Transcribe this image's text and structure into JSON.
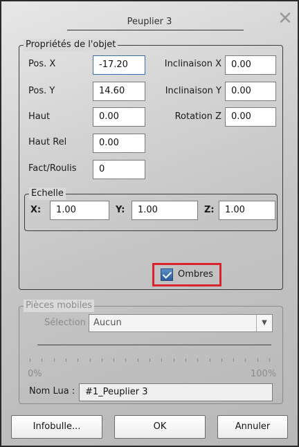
{
  "window": {
    "title": "Peuplier 3"
  },
  "props": {
    "legend": "Propriétés de l'objet",
    "pos_x_label": "Pos. X",
    "pos_x_value": "-17.20",
    "pos_y_label": "Pos. Y",
    "pos_y_value": "14.60",
    "haut_label": "Haut",
    "haut_value": "0.00",
    "haut_rel_label": "Haut Rel",
    "haut_rel_value": "0.00",
    "fact_roulis_label": "Fact/Roulis",
    "fact_roulis_value": "0",
    "incl_x_label": "Inclinaison X",
    "incl_x_value": "0.00",
    "incl_y_label": "Inclinaison Y",
    "incl_y_value": "0.00",
    "rot_z_label": "Rotation Z",
    "rot_z_value": "0.00",
    "scale": {
      "legend": "Echelle",
      "x_label": "X:",
      "x_value": "1.00",
      "y_label": "Y:",
      "y_value": "1.00",
      "z_label": "Z:",
      "z_value": "1.00"
    },
    "shadows_label": "Ombres",
    "shadows_checked": true
  },
  "mobile": {
    "legend": "Pièces mobiles",
    "selection_label": "Sélection",
    "selection_value": "Aucun",
    "slider_min": "0%",
    "slider_max": "100%",
    "lua_label": "Nom Lua :",
    "lua_value": "#1_Peuplier 3"
  },
  "buttons": {
    "tooltip": "Infobulle...",
    "ok": "OK",
    "cancel": "Annuler"
  },
  "colors": {
    "highlight": "#d9232a",
    "focus_border": "#3b6ea8"
  }
}
